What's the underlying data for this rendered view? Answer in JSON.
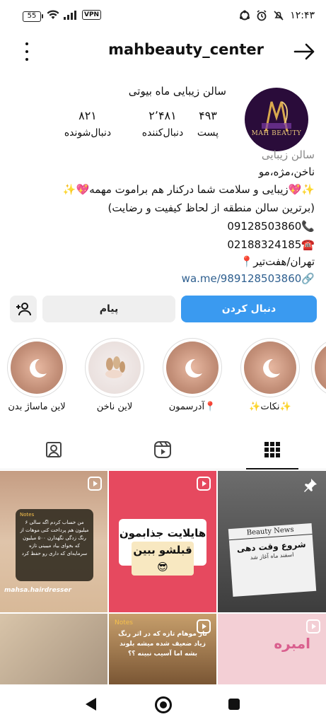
{
  "status_bar": {
    "battery": "55",
    "vpn": "VPN",
    "time": "۱۲:۴۳"
  },
  "header": {
    "username": "mahbeauty_center",
    "menu_icon": "more-vertical-icon",
    "back_icon": "arrow-right-icon"
  },
  "profile": {
    "avatar_caption": "MAH BEAUTY",
    "display_name": "سالن زیبایی ماه بیوتی",
    "stats": [
      {
        "value": "۴۹۳",
        "label": "پست"
      },
      {
        "value": "۲٬۴۸۱",
        "label": "دنبال‌کننده"
      },
      {
        "value": "۸۲۱",
        "label": "دنبال‌شونده"
      }
    ]
  },
  "bio": {
    "category": "سالن زیبایی",
    "line1": "ناخن،مژه،مو",
    "line2": "✨💖زیبایی و سلامت شما درکنار هم براموت مهمه💖✨",
    "line3": "(برترین سالن منطقه از لحاظ کیفیت و رضایت)",
    "line4": "09128503860📞",
    "line5": "02188324185☎️",
    "line6": "📍تهران/هفت‌تیر",
    "line7": "wa.me/989128503860🔗"
  },
  "buttons": {
    "follow": "دنبال کردن",
    "message": "پیام",
    "add_user_icon": "add-user-icon"
  },
  "highlights": [
    {
      "label": "✨نکات✨",
      "type": "moon"
    },
    {
      "label": "آدرسمون📍",
      "type": "moon"
    },
    {
      "label": "لاین ناخن",
      "type": "nails"
    },
    {
      "label": "لاین ماساژ بدن",
      "type": "moon"
    }
  ],
  "tabs": {
    "grid_icon": "grid-icon",
    "reels_icon": "reels-icon",
    "tagged_icon": "tagged-icon"
  },
  "grid": {
    "post1": {
      "notes_header": "Notes",
      "text": "من خساب کردم اگه سالی ۶ میلیون هم پرداخت کنی موهات از رنگ زدگی نگهدارن ۵۰۰ میلیون که بخوای بیاد میبینی تازه سرمایه‌ای که داری رو حفظ کرد",
      "watermark": "mahsa.hairdresser"
    },
    "post2": {
      "line1": "هایلایت جذابمون",
      "line2": "قبلشو ببین😎"
    },
    "post3": {
      "paper_title": "Beauty News",
      "headline": "شروع وقت دهی",
      "sub": "اسفند ماه آغاز شد"
    },
    "post5": {
      "notes_header": "Notes",
      "text": "تار موهام تازه که در اثر رنگ زیاد ضعیف شده میشه بلوند بشه اما آسیب نبینه ؟؟"
    },
    "post6": {
      "word": "امبره"
    }
  },
  "colors": {
    "accent": "#3a9af0",
    "link": "#2e5f8f",
    "muted": "#888888"
  }
}
